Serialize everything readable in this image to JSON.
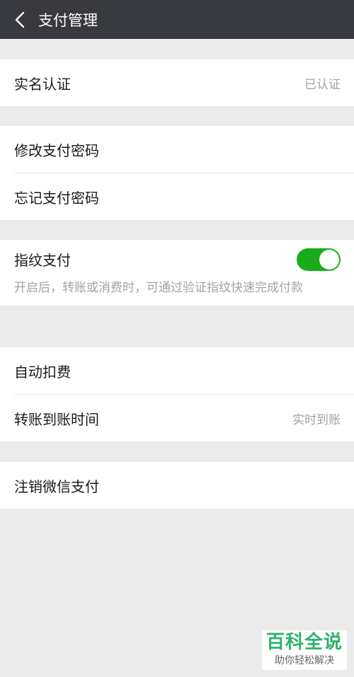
{
  "header": {
    "title": "支付管理",
    "back_icon": "chevron-left-icon"
  },
  "groups": {
    "verify": {
      "label": "实名认证",
      "value": "已认证"
    },
    "password": {
      "change_label": "修改支付密码",
      "forgot_label": "忘记支付密码"
    },
    "fingerprint": {
      "label": "指纹支付",
      "enabled": true,
      "description": "开启后，转账或消费时，可通过验证指纹快速完成付款"
    },
    "payment": {
      "auto_deduct_label": "自动扣费",
      "transfer_time_label": "转账到账时间",
      "transfer_time_value": "实时到账"
    },
    "cancel": {
      "label": "注销微信支付"
    }
  },
  "watermark": {
    "title": "百科全说",
    "subtitle": "助你轻松解决"
  },
  "colors": {
    "accent": "#1aad19",
    "topbar": "#393a3f",
    "background": "#ebebeb"
  }
}
